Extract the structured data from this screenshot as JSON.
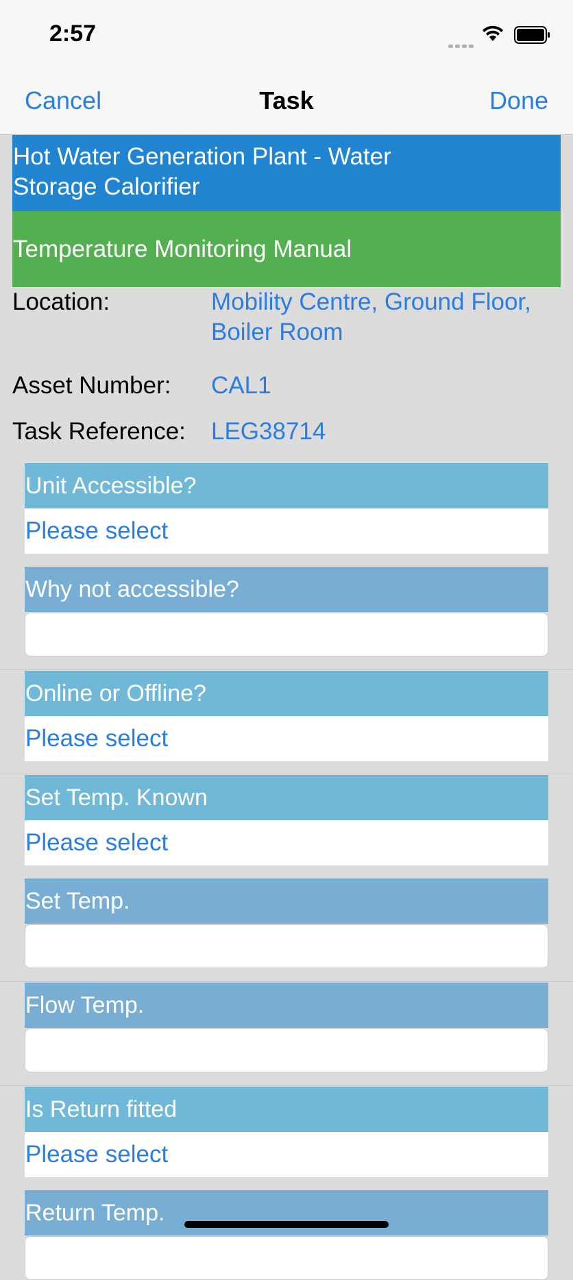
{
  "status": {
    "time": "2:57"
  },
  "nav": {
    "cancel_label": "Cancel",
    "title": "Task",
    "done_label": "Done"
  },
  "task": {
    "asset_title": "Hot Water Generation Plant - Water Storage Calorifier",
    "task_type": "Temperature Monitoring Manual"
  },
  "info": {
    "location_label": "Location:",
    "location_value": "Mobility Centre, Ground Floor, Boiler Room",
    "asset_label": "Asset Number:",
    "asset_value": "CAL1",
    "ref_label": "Task Reference:",
    "ref_value": "LEG38714"
  },
  "questions": [
    {
      "label": "Unit Accessible?",
      "value": "Please select"
    },
    {
      "label": "Why not accessible?",
      "value": ""
    },
    {
      "label": "Online or Offline?",
      "value": "Please select"
    },
    {
      "label": "Set Temp. Known",
      "value": "Please select"
    },
    {
      "label": "Set Temp.",
      "value": ""
    },
    {
      "label": "Flow Temp.",
      "value": ""
    },
    {
      "label": "Is Return fitted",
      "value": "Please select"
    },
    {
      "label": "Return Temp.",
      "value": ""
    }
  ],
  "colors": {
    "accent": "#2a7de1",
    "title_banner": "#2184d0",
    "task_banner": "#52b051",
    "header_cyan": "#6fb8d8",
    "header_steel": "#78aed3"
  }
}
